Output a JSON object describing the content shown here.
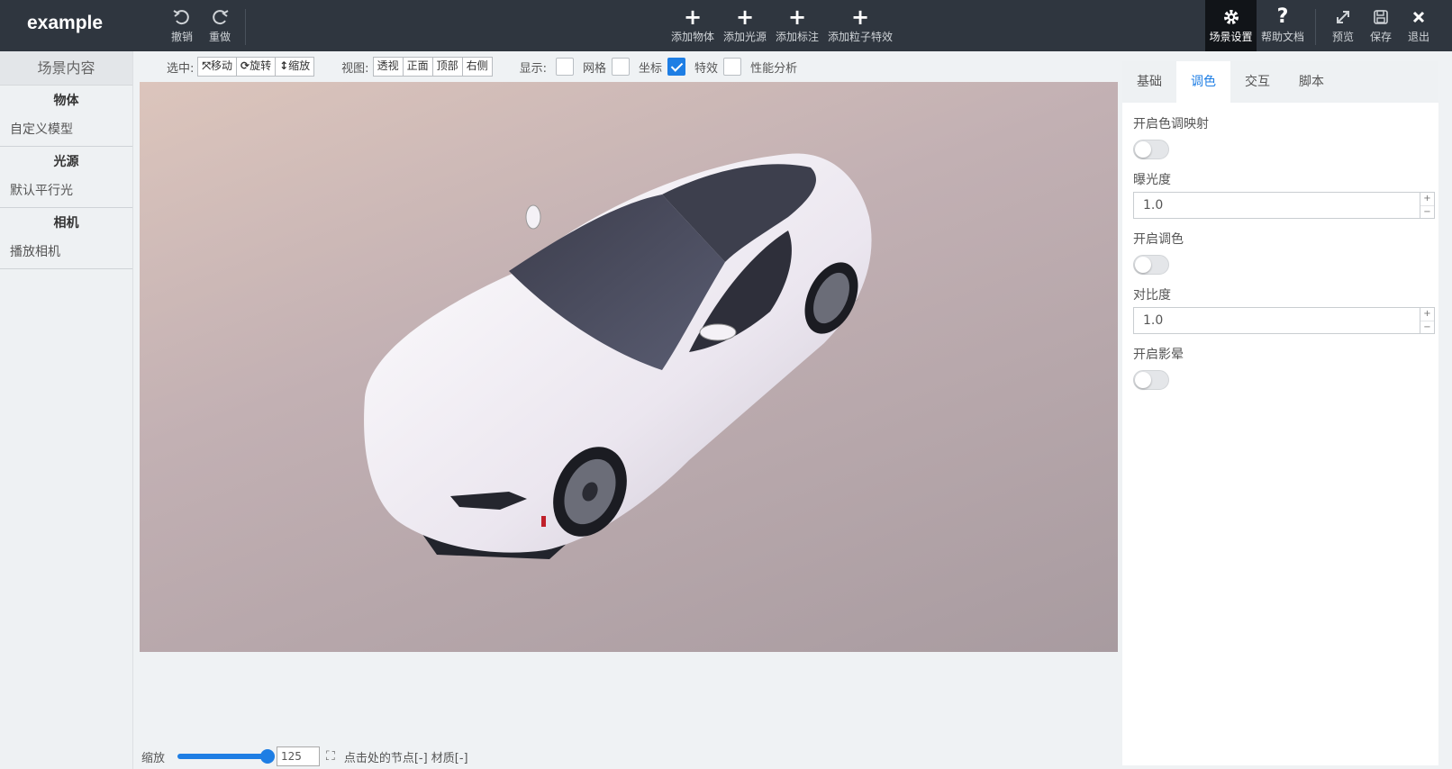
{
  "app": {
    "brand": "example"
  },
  "header": {
    "undo": "撤销",
    "redo": "重做",
    "add_object": "添加物体",
    "add_light": "添加光源",
    "add_label": "添加标注",
    "add_particle": "添加粒子特效",
    "scene_settings": "场景设置",
    "help_docs": "帮助文档",
    "preview": "预览",
    "save": "保存",
    "exit": "退出"
  },
  "sidebar": {
    "title": "场景内容",
    "groups": [
      {
        "label": "物体",
        "items": [
          "自定义模型"
        ]
      },
      {
        "label": "光源",
        "items": [
          "默认平行光"
        ]
      },
      {
        "label": "相机",
        "items": [
          "播放相机"
        ]
      }
    ]
  },
  "toolbar": {
    "select_label": "选中:",
    "select_modes": [
      "移动",
      "旋转",
      "缩放"
    ],
    "view_label": "视图:",
    "views": [
      "透视",
      "正面",
      "顶部",
      "右侧"
    ],
    "display_label": "显示:",
    "display_options": [
      {
        "label": "网格",
        "checked": false
      },
      {
        "label": "坐标",
        "checked": false
      },
      {
        "label": "特效",
        "checked": true
      },
      {
        "label": "性能分析",
        "checked": false
      }
    ]
  },
  "bottom": {
    "zoom_label": "缩放",
    "zoom_value": "125",
    "zoom_fraction": 1.0,
    "node_info": "点击处的节点[-] 材质[-]"
  },
  "right_panel": {
    "tabs": [
      "基础",
      "调色",
      "交互",
      "脚本"
    ],
    "active_tab": "调色",
    "tone_mapping_label": "开启色调映射",
    "tone_mapping_on": false,
    "exposure_label": "曝光度",
    "exposure_value": "1.0",
    "color_grading_label": "开启调色",
    "color_grading_on": false,
    "contrast_label": "对比度",
    "contrast_value": "1.0",
    "vignette_label": "开启影晕",
    "vignette_on": false
  },
  "colors": {
    "topbar": "#2f363f",
    "accent": "#1e7ee4",
    "car_body": "#f3eef4"
  }
}
